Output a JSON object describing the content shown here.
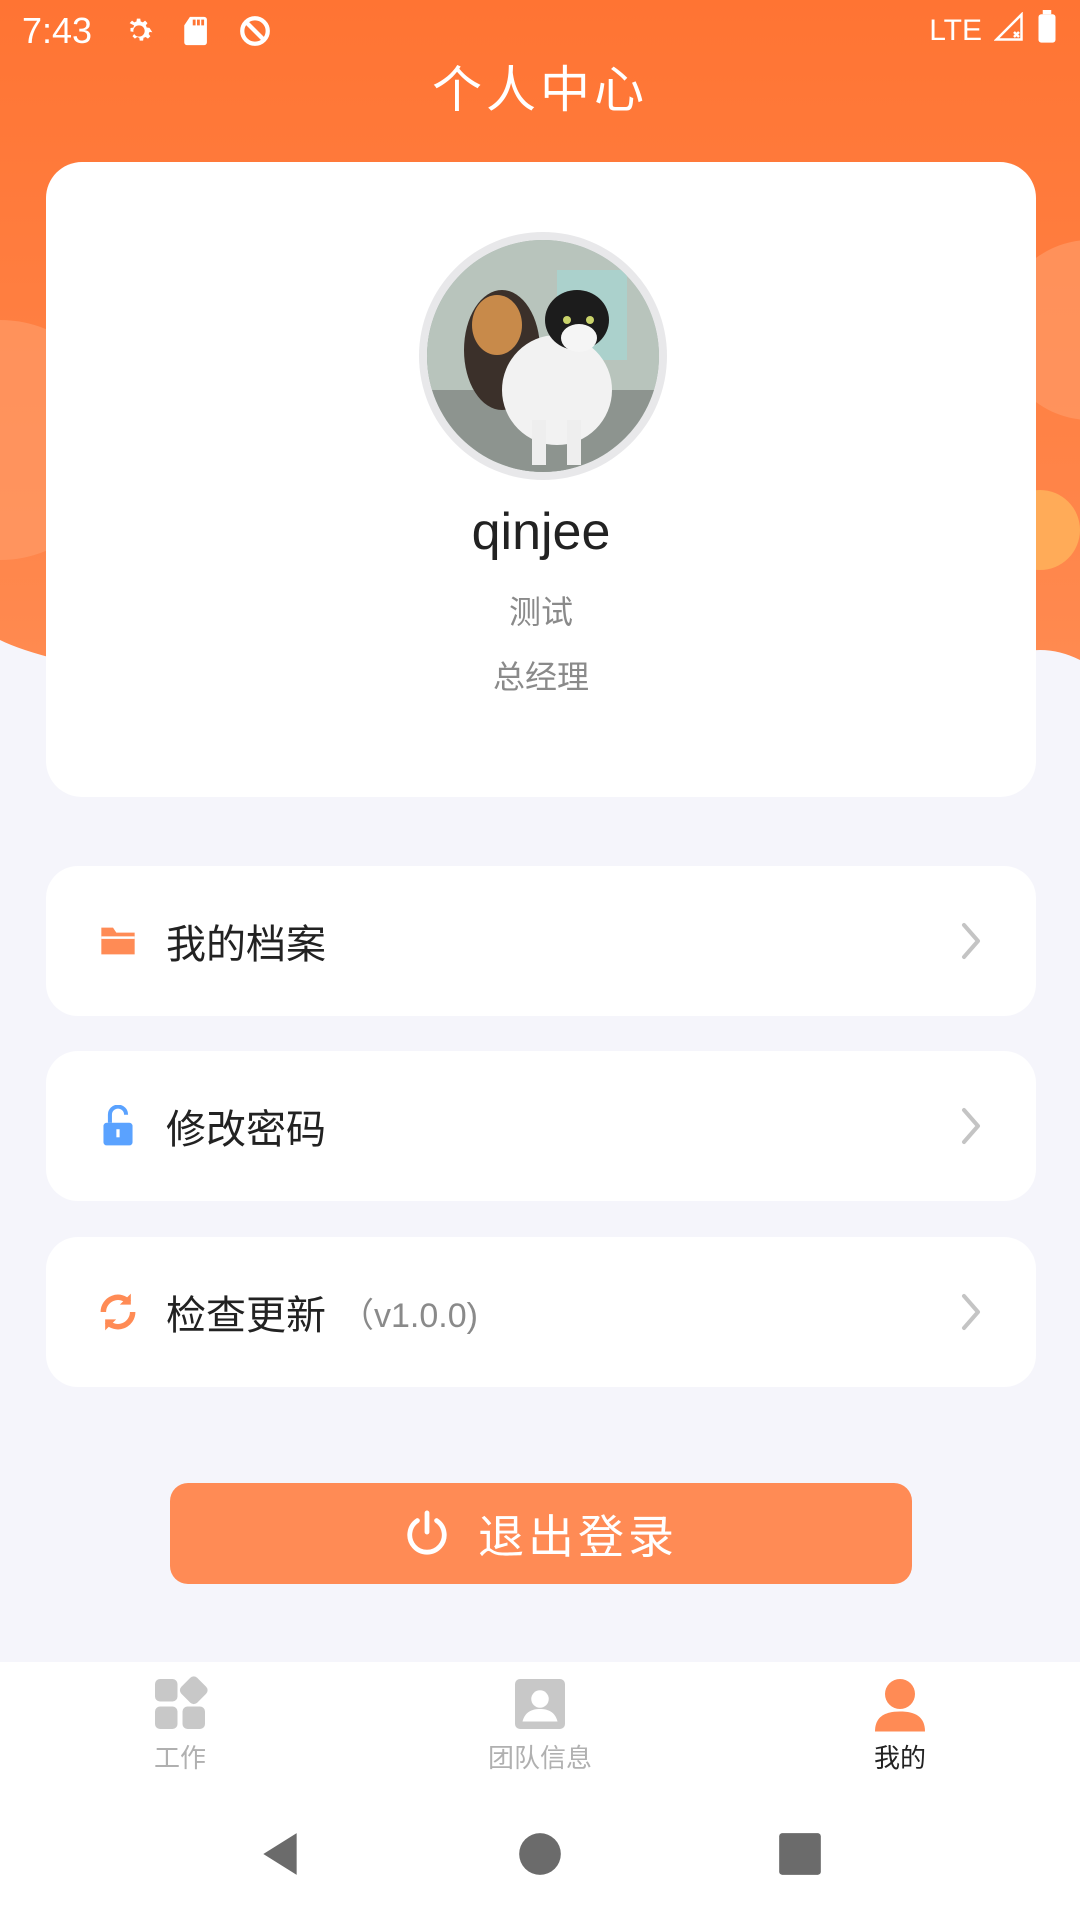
{
  "status_bar": {
    "time": "7:43",
    "network": "LTE"
  },
  "header": {
    "title": "个人中心"
  },
  "profile": {
    "username": "qinjee",
    "department": "测试",
    "position": "总经理"
  },
  "menu": [
    {
      "label": "我的档案",
      "icon": "folder-icon",
      "color": "#ff8b55"
    },
    {
      "label": "修改密码",
      "icon": "unlock-icon",
      "color": "#5aa2ff"
    },
    {
      "label": "检查更新",
      "version": "（v1.0.0)",
      "icon": "refresh-icon",
      "color": "#ff8b55"
    }
  ],
  "logout": {
    "label": "退出登录"
  },
  "bottom_nav": [
    {
      "label": "工作",
      "icon": "apps-icon",
      "active": false
    },
    {
      "label": "团队信息",
      "icon": "contact-card-icon",
      "active": false
    },
    {
      "label": "我的",
      "icon": "person-icon",
      "active": true
    }
  ],
  "colors": {
    "accent": "#ff8b55",
    "header_bg": "#ff7a3d"
  }
}
